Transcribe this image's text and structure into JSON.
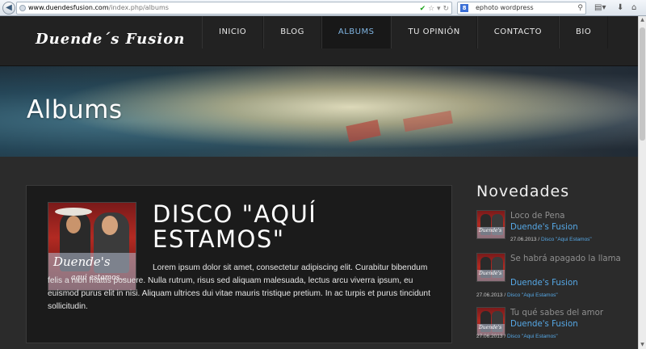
{
  "browser": {
    "url_host": "www.duendesfusion.com",
    "url_path": "/index.php/albums",
    "search_text": "ephoto wordpress"
  },
  "site": {
    "logo": "Duende´s Fusion",
    "menu": [
      {
        "label": "INICIO",
        "active": false
      },
      {
        "label": "BLOG",
        "active": false
      },
      {
        "label": "ALBUMS",
        "active": true
      },
      {
        "label": "TU OPINIÓN",
        "active": false
      },
      {
        "label": "CONTACTO",
        "active": false
      },
      {
        "label": "BIO",
        "active": false
      }
    ]
  },
  "banner": {
    "title": "Albums"
  },
  "post": {
    "title": "DISCO \"AQUÍ ESTAMOS\"",
    "cover_title": "Duende's",
    "cover_subtitle": "aqui estamos...",
    "body": "Lorem ipsum dolor sit amet, consectetur adipiscing elit. Curabitur bibendum felis a nibh mattis posuere. Nulla rutrum, risus sed aliquam malesuada, lectus arcu viverra ipsum, eu euismod purus elit in nisi. Aliquam ultrices dui vitae mauris tristique pretium. In ac turpis et purus tincidunt sollicitudin."
  },
  "sidebar": {
    "title": "Novedades",
    "items": [
      {
        "song": "Loco de Pena",
        "artist": "Duende's Fusion",
        "date": "27.06.2013",
        "separator": " / ",
        "album": "Disco \"Aqui Estamos\"",
        "thumb_text": "Duende's"
      },
      {
        "song": "Se habrá apagado la llama",
        "artist": "Duende's Fusion",
        "date": "27.06.2013",
        "separator": " / ",
        "album": "Disco \"Aqui Estamos\"",
        "thumb_text": "Duende's"
      },
      {
        "song": "Tu qué sabes del amor",
        "artist": "Duende's Fusion",
        "date": "27.06.2013",
        "separator": " / ",
        "album": "Disco \"Aqui Estamos\"",
        "thumb_text": "Duende's"
      }
    ]
  },
  "icons": {
    "back": "back-arrow-icon",
    "verified": "check-icon",
    "star": "star-icon",
    "reload": "reload-icon",
    "search": "search-icon",
    "download": "download-icon",
    "home": "home-icon"
  }
}
